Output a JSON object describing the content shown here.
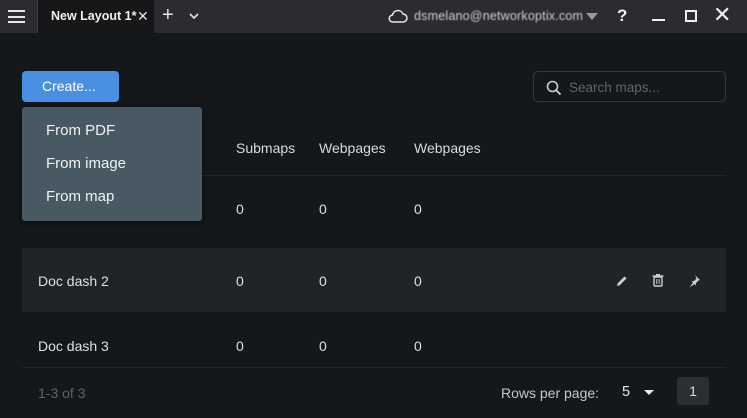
{
  "titlebar": {
    "tab_label": "New Layout 1*",
    "tab_close": "✕",
    "new_tab": "+",
    "account_email": "dsmelano@networkoptix.com",
    "help": "?",
    "close": "✕"
  },
  "toolbar": {
    "create_label": "Create...",
    "search_placeholder": "Search maps..."
  },
  "create_menu": {
    "items": [
      "From PDF",
      "From image",
      "From map"
    ]
  },
  "table": {
    "columns": [
      "Submaps",
      "Webpages",
      "Webpages"
    ],
    "rows": [
      {
        "name": "",
        "submaps": "0",
        "webpages_a": "0",
        "webpages_b": "0"
      },
      {
        "name": "Doc dash 2",
        "submaps": "0",
        "webpages_a": "0",
        "webpages_b": "0"
      },
      {
        "name": "Doc dash 3",
        "submaps": "0",
        "webpages_a": "0",
        "webpages_b": "0"
      }
    ]
  },
  "row_actions": [
    "edit-icon",
    "delete-icon",
    "pin-icon"
  ],
  "footer": {
    "count_text": "1-3 of 3",
    "rows_per_page_label": "Rows per page:",
    "rows_per_page_value": "5",
    "current_page": "1"
  },
  "colors": {
    "accent": "#4a90e2",
    "background": "#15181b",
    "titlebar": "#2a2c2f",
    "menu": "#485963",
    "row_highlight": "#202427"
  }
}
